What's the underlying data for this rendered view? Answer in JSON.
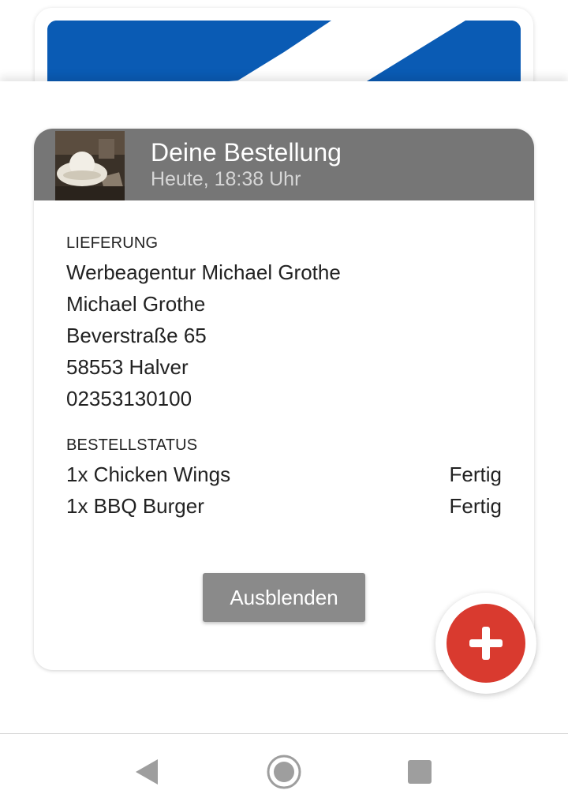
{
  "order": {
    "title": "Deine Bestellung",
    "subtitle": "Heute, 18:38 Uhr",
    "thumbnail_icon": "cowboy-hat-photo",
    "delivery_label": "LIEFERUNG",
    "address_lines": [
      "Werbeagentur Michael Grothe",
      "Michael Grothe",
      "Beverstraße 65",
      "58553 Halver",
      "02353130100"
    ],
    "status_label": "BESTELLSTATUS",
    "items": [
      {
        "name": "1x Chicken Wings",
        "status": "Fertig"
      },
      {
        "name": "1x BBQ Burger",
        "status": "Fertig"
      }
    ],
    "hide_button_label": "Ausblenden"
  },
  "fab": {
    "icon": "plus-icon",
    "color": "#d93a2f"
  },
  "nav": {
    "icons": [
      "back-icon",
      "home-icon",
      "recents-icon"
    ]
  },
  "colors": {
    "header_bg": "#767676",
    "banner_blue": "#0a5bb4",
    "button_bg": "#8a8a8a"
  }
}
